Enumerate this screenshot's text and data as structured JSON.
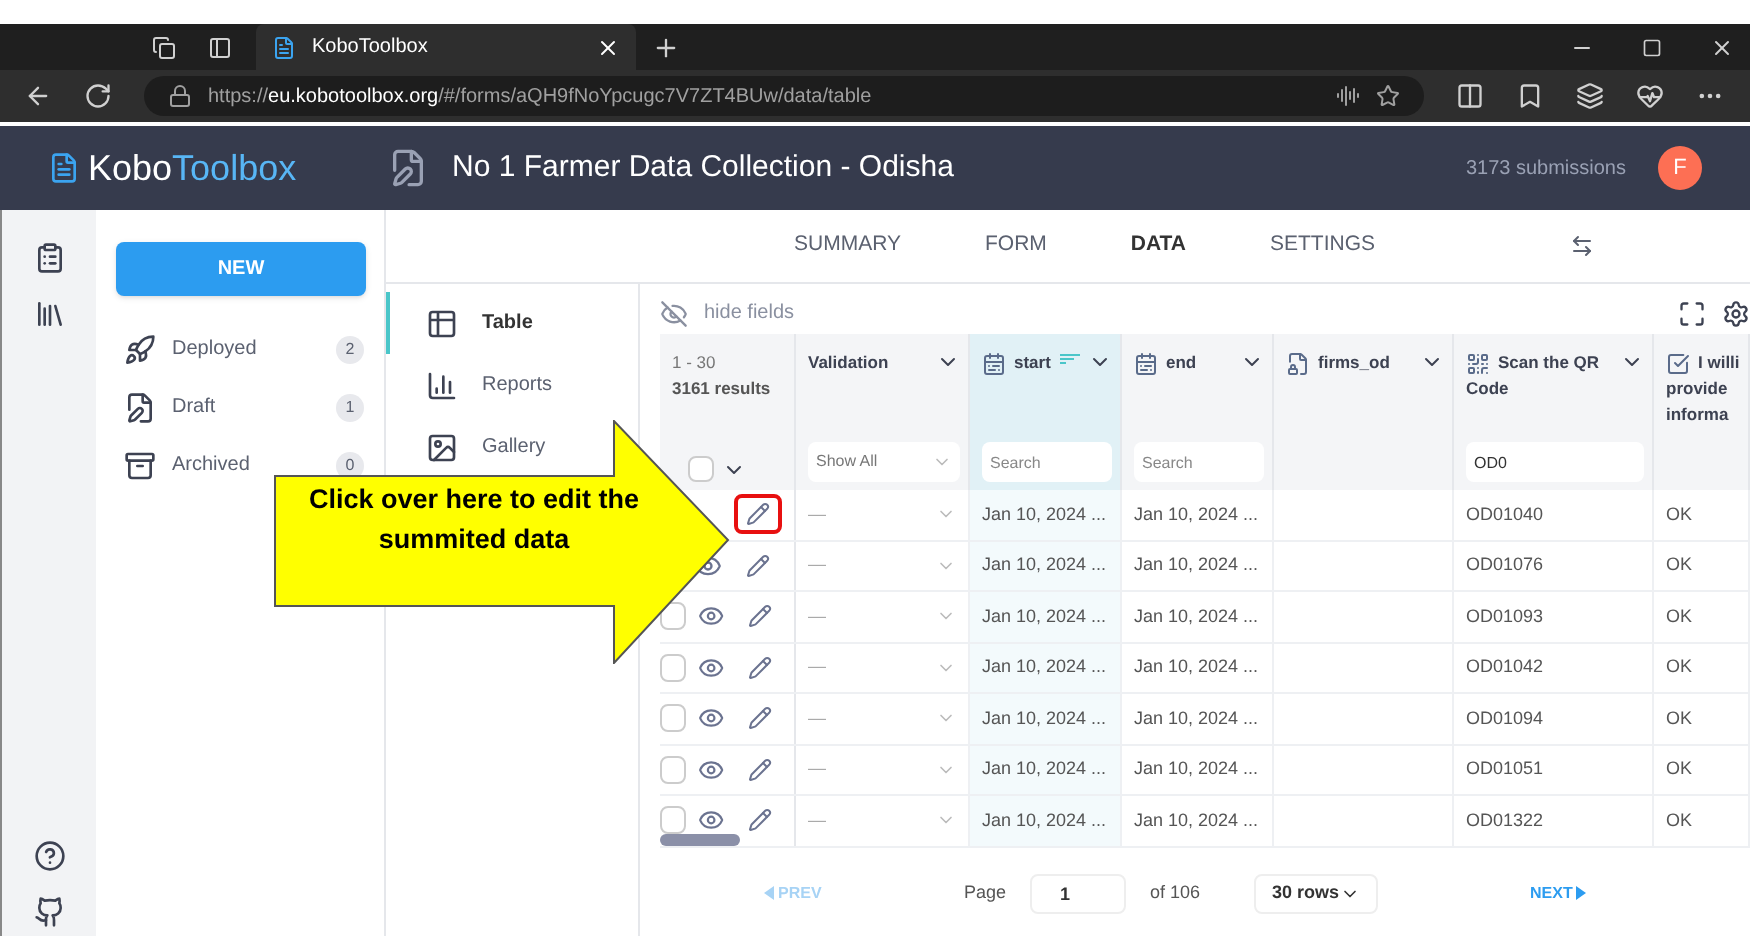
{
  "browser": {
    "tabs": [
      {
        "title": "KoboToolbox",
        "selected": true
      }
    ],
    "url": "https://**eu.kobotoolbox.org**/#/forms/aQH9fNoYpcugc7V7ZT4BUw/data/table"
  },
  "header": {
    "logo_bold": "Kobo",
    "logo_light": "Toolbox",
    "form_title": "No  1 Farmer Data Collection - Odisha",
    "submissions": "3173 submissions",
    "avatar": "F"
  },
  "sidebar": {
    "new_button": "NEW",
    "items": [
      {
        "kind": "deployed",
        "label": "Deployed",
        "count": "2"
      },
      {
        "kind": "draft",
        "label": "Draft",
        "count": "1"
      },
      {
        "kind": "archived",
        "label": "Archived",
        "count": "0"
      }
    ]
  },
  "top_tabs": [
    {
      "label": "SUMMARY",
      "selected": false
    },
    {
      "label": "FORM",
      "selected": false
    },
    {
      "label": "DATA",
      "selected": true
    },
    {
      "label": "SETTINGS",
      "selected": false
    }
  ],
  "data_nav": [
    {
      "kind": "table",
      "label": "Table",
      "selected": true
    },
    {
      "kind": "reports",
      "label": "Reports",
      "selected": false
    },
    {
      "kind": "gallery",
      "label": "Gallery",
      "selected": false
    }
  ],
  "table": {
    "hide_fields": "hide fields",
    "range": "1 - 30",
    "results": "3161 results",
    "select_all_checked": false,
    "columns": [
      {
        "kind": "status",
        "label_lines": [
          "Validation"
        ],
        "sorted": false,
        "filter": {
          "kind": "select",
          "placeholder": "Show All"
        }
      },
      {
        "kind": "date",
        "label_lines": [
          "start"
        ],
        "sorted": true,
        "filter": {
          "kind": "search",
          "placeholder": "Search"
        }
      },
      {
        "kind": "date",
        "label_lines": [
          "end"
        ],
        "sorted": false,
        "filter": {
          "kind": "search",
          "placeholder": "Search"
        }
      },
      {
        "kind": "file",
        "label_lines": [
          "firms_od"
        ],
        "sorted": false,
        "filter": {
          "kind": "none"
        }
      },
      {
        "kind": "qr",
        "label_lines": [
          "Scan the QR",
          "Code"
        ],
        "sorted": false,
        "filter": {
          "kind": "search",
          "value": "OD0"
        }
      },
      {
        "kind": "checkbox",
        "label_lines": [
          "I willi",
          "provide",
          "informa"
        ],
        "sorted": false,
        "filter": {
          "kind": "none"
        }
      }
    ],
    "rows": [
      {
        "kind": "edit-only",
        "highlighted": true,
        "cells": [
          "—",
          "Jan 10, 2024 ...",
          "Jan 10, 2024 ...",
          null,
          "OD01040",
          "OK"
        ]
      },
      {
        "kind": "view-edit",
        "highlighted": false,
        "cells": [
          "—",
          "Jan 10, 2024 ...",
          "Jan 10, 2024 ...",
          null,
          "OD01076",
          "OK"
        ]
      },
      {
        "kind": "full",
        "checked": false,
        "highlighted": false,
        "cells": [
          "—",
          "Jan 10, 2024 ...",
          "Jan 10, 2024 ...",
          null,
          "OD01093",
          "OK"
        ]
      },
      {
        "kind": "full",
        "checked": false,
        "highlighted": false,
        "cells": [
          "—",
          "Jan 10, 2024 ...",
          "Jan 10, 2024 ...",
          null,
          "OD01042",
          "OK"
        ]
      },
      {
        "kind": "full",
        "checked": false,
        "highlighted": false,
        "cells": [
          "—",
          "Jan 10, 2024 ...",
          "Jan 10, 2024 ...",
          null,
          "OD01094",
          "OK"
        ]
      },
      {
        "kind": "full",
        "checked": false,
        "highlighted": false,
        "cells": [
          "—",
          "Jan 10, 2024 ...",
          "Jan 10, 2024 ...",
          null,
          "OD01051",
          "OK"
        ]
      },
      {
        "kind": "full",
        "checked": false,
        "highlighted": false,
        "cells": [
          "—",
          "Jan 10, 2024 ...",
          "Jan 10, 2024 ...",
          null,
          "OD01322",
          "OK"
        ]
      }
    ]
  },
  "pagination": {
    "prev": {
      "label": "PREV",
      "disabled": true
    },
    "page_label": "Page",
    "page": "1",
    "of": "of 106",
    "rows_select": "30 rows",
    "next": {
      "label": "NEXT",
      "disabled": false
    }
  },
  "callout": {
    "lines": [
      "Click  over here to edit the",
      "summited data"
    ]
  }
}
